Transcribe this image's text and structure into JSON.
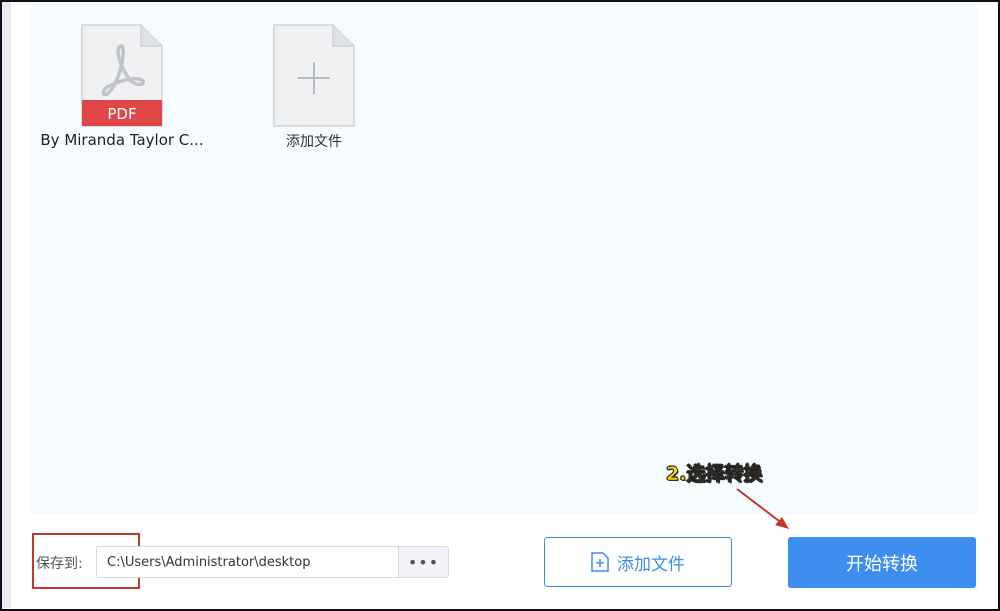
{
  "files": [
    {
      "name": "By Miranda Taylor C...",
      "badge": "PDF",
      "icon": "pdf-file-icon"
    }
  ],
  "add_tile": {
    "label": "添加文件",
    "icon": "add-file-plus-icon"
  },
  "save": {
    "label": "保存到:",
    "path": "C:\\Users\\Administrator\\desktop",
    "browse_label": "•••"
  },
  "buttons": {
    "add_file_label": "添加文件",
    "start_label": "开始转换"
  },
  "annotation": {
    "text": "2.选择转换"
  },
  "colors": {
    "accent": "#3e8ef0",
    "pdf_badge": "#e04848",
    "annotation": "#ffd700",
    "highlight": "#c0392b"
  }
}
